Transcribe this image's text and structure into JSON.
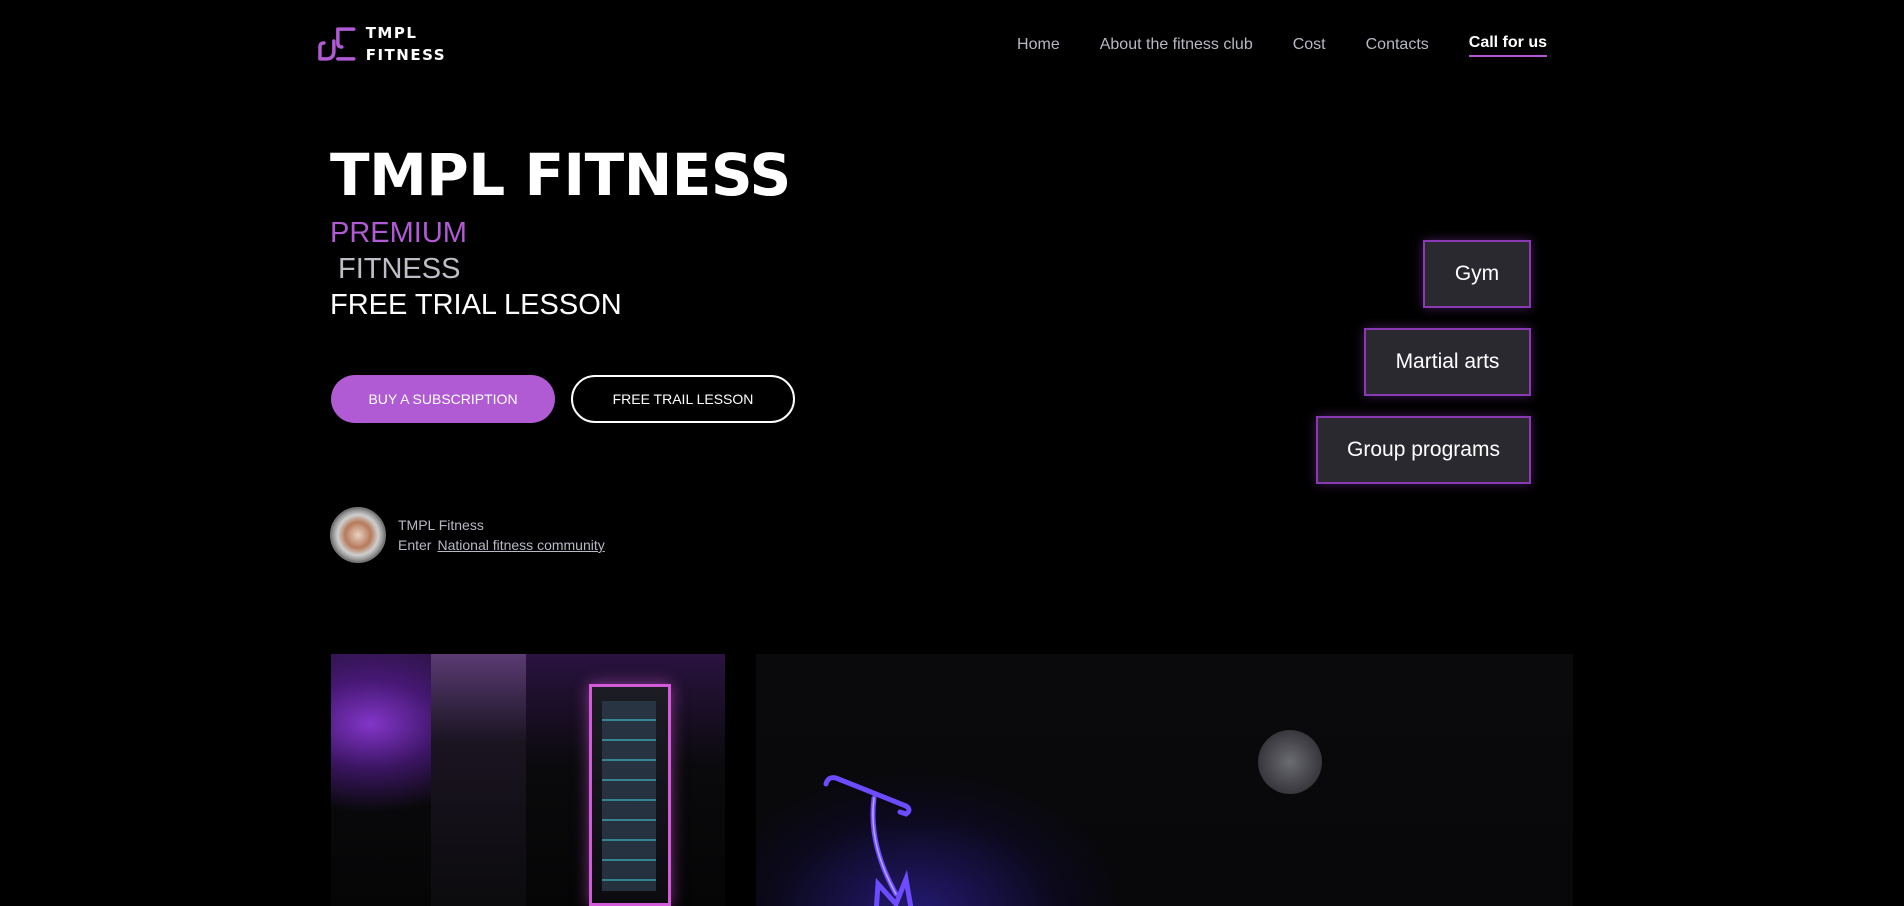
{
  "brand": {
    "name_line1": "TMPL",
    "name_line2": "FITNESS",
    "accent_color": "#b05ad4",
    "logo_icon": "tmpl-logo-icon"
  },
  "nav": {
    "items": [
      {
        "label": "Home"
      },
      {
        "label": "About the fitness club"
      },
      {
        "label": "Cost"
      },
      {
        "label": "Contacts"
      },
      {
        "label": "Call for us"
      }
    ]
  },
  "hero": {
    "title": "TMPL FITNESS",
    "sub_premium": "PREMIUM",
    "sub_fitness": "FITNESS",
    "sub_trial": "FREE TRIAL LESSON",
    "buy_button": "BUY A SUBSCRIPTION",
    "trial_button": "FREE TRAIL LESSON"
  },
  "community": {
    "name": "TMPL Fitness",
    "enter_label": "Enter",
    "link_label": "National fitness community"
  },
  "cards": [
    {
      "label": "Gym"
    },
    {
      "label": "Martial arts"
    },
    {
      "label": "Group programs"
    }
  ]
}
